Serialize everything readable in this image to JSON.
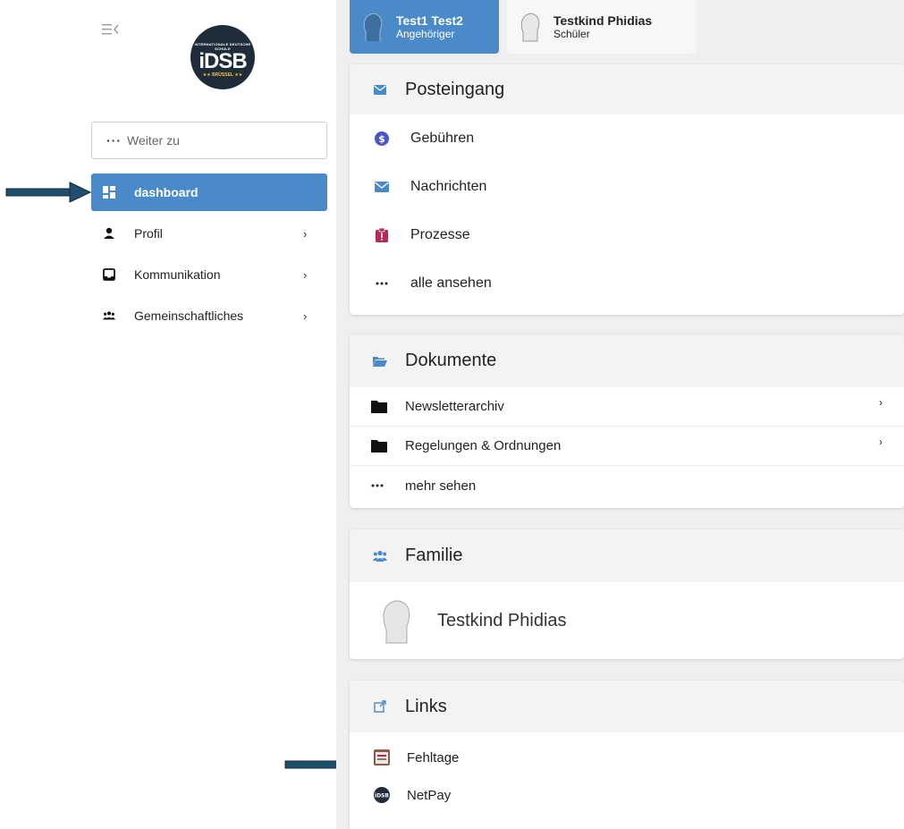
{
  "sidebar": {
    "logo": {
      "top_text": "INTERNATIONALE DEUTSCHE SCHULE",
      "main_text": "iDSB",
      "bottom_text": "★★ BRÜSSEL ★★"
    },
    "search": {
      "placeholder": "Weiter zu"
    },
    "nav": [
      {
        "label": "dashboard",
        "icon": "dashboard-icon",
        "active": true
      },
      {
        "label": "Profil",
        "icon": "user-icon",
        "chevron": "›"
      },
      {
        "label": "Kommunikation",
        "icon": "inbox-icon",
        "chevron": "›"
      },
      {
        "label": "Gemeinschaftliches",
        "icon": "users-icon",
        "chevron": "›"
      }
    ]
  },
  "tabs": [
    {
      "name": "Test1 Test2",
      "role": "Angehöriger",
      "active": true
    },
    {
      "name": "Testkind Phidias",
      "role": "Schüler",
      "active": false
    }
  ],
  "posteingang": {
    "title": "Posteingang",
    "items": [
      {
        "label": "Gebühren",
        "icon": "dollar-circle-icon"
      },
      {
        "label": "Nachrichten",
        "icon": "envelope-icon"
      },
      {
        "label": "Prozesse",
        "icon": "clipboard-alert-icon"
      },
      {
        "label": "alle ansehen",
        "icon": "ellipsis-icon"
      }
    ]
  },
  "dokumente": {
    "title": "Dokumente",
    "items": [
      {
        "label": "Newsletterarchiv",
        "icon": "folder-icon",
        "chevron": "›"
      },
      {
        "label": "Regelungen & Ordnungen",
        "icon": "folder-icon",
        "chevron": "›"
      },
      {
        "label": "mehr sehen",
        "icon": "ellipsis-icon"
      }
    ]
  },
  "familie": {
    "title": "Familie",
    "members": [
      {
        "name": "Testkind Phidias"
      }
    ]
  },
  "links": {
    "title": "Links",
    "items": [
      {
        "label": "Fehltage",
        "icon": "calendar-app-icon"
      },
      {
        "label": "NetPay",
        "icon": "idsb-app-icon"
      }
    ]
  },
  "colors": {
    "accent": "#4a8ac8",
    "money": "#4a55c8",
    "alert": "#b2295a",
    "arrow": "#1f4e6e"
  }
}
